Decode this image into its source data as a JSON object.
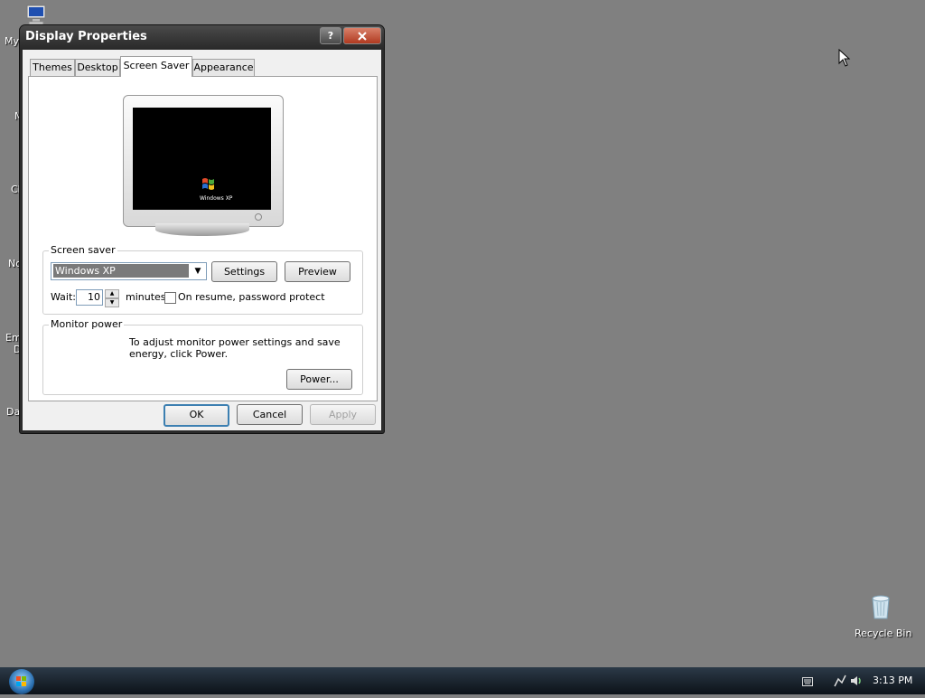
{
  "desktop": {
    "icon_labels": [
      "My",
      "M",
      "Cl",
      "No",
      "Em",
      "D",
      "Da"
    ],
    "recycle_bin_label": "Recycle Bin"
  },
  "dialog": {
    "title": "Display Properties",
    "help_label": "?",
    "tabs": [
      "Themes",
      "Desktop",
      "Screen Saver",
      "Appearance"
    ],
    "active_tab": "Screen Saver",
    "preview_brand": "Windows XP",
    "screen_saver": {
      "group_label": "Screen saver",
      "selected": "Windows XP",
      "settings_label": "Settings",
      "preview_label": "Preview",
      "wait_label": "Wait:",
      "wait_value": "10",
      "minutes_label": "minutes",
      "password_label": "On resume, password protect"
    },
    "monitor_power": {
      "group_label": "Monitor power",
      "text": "To adjust monitor power settings and save energy, click Power.",
      "power_label": "Power..."
    },
    "ok_label": "OK",
    "cancel_label": "Cancel",
    "apply_label": "Apply"
  },
  "taskbar": {
    "clock": "3:13 PM"
  }
}
